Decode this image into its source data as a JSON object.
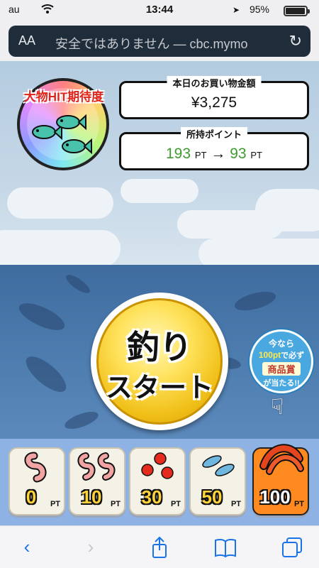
{
  "status": {
    "carrier": "au",
    "time": "13:44",
    "battery": "95%"
  },
  "urlbar": {
    "aa": "AA",
    "url": "安全ではありません — cbc.mymo"
  },
  "game": {
    "gauge_label": "大物HIT期待度",
    "purchase": {
      "label": "本日のお買い物金額",
      "amount": "¥3,275"
    },
    "points": {
      "label": "所持ポイント",
      "current": "193",
      "after": "93",
      "unit": "PT",
      "arrow": "→"
    },
    "start": {
      "line1": "釣り",
      "line2": "スタート"
    },
    "promo": {
      "line1": "今なら",
      "line2_num": "100pt",
      "line2_text": "で必ず",
      "line3": "商品賞",
      "line4": "が当たる!!"
    },
    "baits": [
      {
        "amount": "0",
        "unit": "PT",
        "icon": "worm-icon"
      },
      {
        "amount": "10",
        "unit": "PT",
        "icon": "worms-icon"
      },
      {
        "amount": "30",
        "unit": "PT",
        "icon": "fish-eggs-icon"
      },
      {
        "amount": "50",
        "unit": "PT",
        "icon": "sardines-icon"
      },
      {
        "amount": "100",
        "unit": "PT",
        "icon": "shrimp-icon",
        "selected": true
      }
    ]
  },
  "toolbar": [
    "back-icon",
    "forward-icon",
    "share-icon",
    "bookmarks-icon",
    "tabs-icon"
  ],
  "colors": {
    "sky": "#c6d8e7",
    "sea": "#4c7bae",
    "baitbar": "#8fb2e5",
    "start_gold": "#f0bf17",
    "accent_red": "#e0231b",
    "point_green": "#3e9b2f"
  }
}
